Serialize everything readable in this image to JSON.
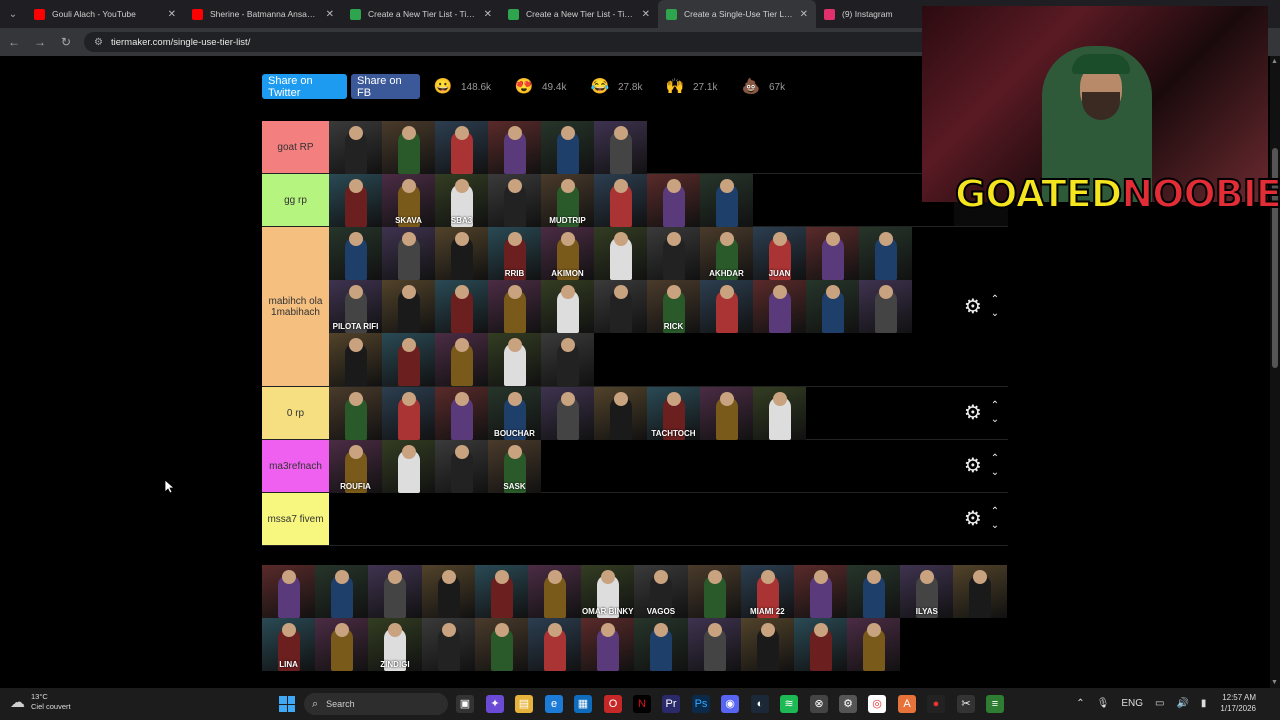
{
  "browser": {
    "tabs": [
      {
        "title": "Gouli Alach - YouTube",
        "icon": "youtube-icon",
        "color": "#ff0000",
        "active": false
      },
      {
        "title": "Sherine - Batmanna Ansak | ال",
        "icon": "youtube-icon",
        "color": "#ff0000",
        "active": false
      },
      {
        "title": "Create a New Tier List - TierMa",
        "icon": "tiermaker-icon",
        "color": "#2ea44f",
        "active": false
      },
      {
        "title": "Create a New Tier List - TierMa",
        "icon": "tiermaker-icon",
        "color": "#2ea44f",
        "active": false
      },
      {
        "title": "Create a Single-Use Tier List (R",
        "icon": "tiermaker-icon",
        "color": "#2ea44f",
        "active": true
      },
      {
        "title": "(9) Instagram",
        "icon": "instagram-icon",
        "color": "#e1306c",
        "active": false
      }
    ],
    "url": "tiermaker.com/single-use-tier-list/"
  },
  "share": {
    "twitter": "Share on Twitter",
    "facebook": "Share on FB"
  },
  "reactions": [
    {
      "icon": "grin-emoji-icon",
      "glyph": "😀",
      "count": "148.6k"
    },
    {
      "icon": "heart-eyes-emoji-icon",
      "glyph": "😍",
      "count": "49.4k"
    },
    {
      "icon": "laughing-emoji-icon",
      "glyph": "😂",
      "count": "27.8k"
    },
    {
      "icon": "raised-hands-emoji-icon",
      "glyph": "🙌",
      "count": "27.1k"
    },
    {
      "icon": "poop-emoji-icon",
      "glyph": "💩",
      "count": "67k"
    }
  ],
  "tiers": [
    {
      "label": "goat RP",
      "color": "#f47f7f",
      "items": [
        "",
        "",
        "",
        "",
        "",
        ""
      ],
      "captions": [
        "",
        "",
        "",
        "",
        "",
        ""
      ],
      "height": 1
    },
    {
      "label": "gg rp",
      "color": "#b4f47f",
      "items": [
        "",
        "",
        "",
        "",
        "",
        "",
        "",
        ""
      ],
      "captions": [
        "",
        "SKAVA",
        "SBA3",
        "",
        "MUDTRIP",
        "",
        "",
        ""
      ],
      "height": 1
    },
    {
      "label": "mabihch ola 1mabihach",
      "color": "#f5bf80",
      "items": [
        "",
        "",
        "",
        "",
        "",
        "",
        "",
        "",
        "",
        "",
        "",
        "",
        "",
        "",
        "",
        "",
        "",
        "",
        "",
        "",
        "",
        "",
        "",
        "",
        "",
        "",
        ""
      ],
      "captions": [
        "",
        "",
        "",
        "RRIB",
        "AKIMON",
        "",
        "",
        "AKHDAR",
        "JUAN",
        "",
        "",
        "PILOTA RIFI",
        "",
        "",
        "",
        "",
        "",
        "RICK",
        "",
        "",
        "",
        "",
        "",
        "",
        "",
        "",
        ""
      ],
      "height": 3
    },
    {
      "label": "0 rp",
      "color": "#f5df80",
      "items": [
        "",
        "",
        "",
        "",
        "",
        "",
        "",
        "",
        ""
      ],
      "captions": [
        "",
        "",
        "",
        "BOUCHAR",
        "",
        "",
        "TACHTOCH",
        "",
        ""
      ],
      "height": 1
    },
    {
      "label": "ma3refnach",
      "color": "#f060f0",
      "items": [
        "",
        "",
        "",
        ""
      ],
      "captions": [
        "ROUFIA",
        "",
        "",
        "SASK"
      ],
      "height": 1
    },
    {
      "label": "mssa7 fivem",
      "color": "#f7f77f",
      "items": [],
      "captions": [],
      "height": 1
    }
  ],
  "pool": {
    "captions": [
      "",
      "",
      "",
      "",
      "",
      "",
      "OMAR BINKY",
      "VAGOS",
      "",
      "MIAMI 22",
      "",
      "",
      "ILYAS",
      "",
      "LINA",
      "",
      "ZINDIGI",
      "",
      "",
      "",
      "",
      "",
      "",
      "",
      "",
      ""
    ]
  },
  "stream": {
    "title_part1": "GOATED",
    "title_part2": "NOOBIE"
  },
  "taskbar": {
    "temperature": "13°C",
    "weather": "Ciel couvert",
    "search_placeholder": "Search",
    "lang": "ENG",
    "time": "12:57 AM",
    "date": "1/17/2026"
  }
}
